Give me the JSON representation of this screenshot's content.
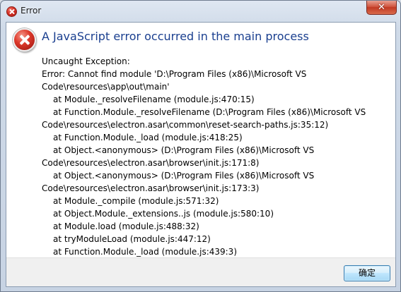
{
  "window": {
    "title": "Error",
    "close_label": "✕"
  },
  "dialog": {
    "heading": "A JavaScript error occurred in the main process",
    "message_lines": [
      {
        "text": "Uncaught Exception:",
        "indent": false
      },
      {
        "text": "Error: Cannot find module 'D:\\Program Files (x86)\\Microsoft VS",
        "indent": false
      },
      {
        "text": "Code\\resources\\app\\out\\main'",
        "indent": false
      },
      {
        "text": "at Module._resolveFilename (module.js:470:15)",
        "indent": true
      },
      {
        "text": "at Function.Module._resolveFilename (D:\\Program Files (x86)\\Microsoft VS",
        "indent": true
      },
      {
        "text": "Code\\resources\\electron.asar\\common\\reset-search-paths.js:35:12)",
        "indent": false
      },
      {
        "text": "at Function.Module._load (module.js:418:25)",
        "indent": true
      },
      {
        "text": "at Object.<anonymous> (D:\\Program Files (x86)\\Microsoft VS",
        "indent": true
      },
      {
        "text": "Code\\resources\\electron.asar\\browser\\init.js:171:8)",
        "indent": false
      },
      {
        "text": "at Object.<anonymous> (D:\\Program Files (x86)\\Microsoft VS",
        "indent": true
      },
      {
        "text": "Code\\resources\\electron.asar\\browser\\init.js:173:3)",
        "indent": false
      },
      {
        "text": "at Module._compile (module.js:571:32)",
        "indent": true
      },
      {
        "text": "at Object.Module._extensions..js (module.js:580:10)",
        "indent": true
      },
      {
        "text": "at Module.load (module.js:488:32)",
        "indent": true
      },
      {
        "text": "at tryModuleLoad (module.js:447:12)",
        "indent": true
      },
      {
        "text": "at Function.Module._load (module.js:439:3)",
        "indent": true
      }
    ],
    "ok_label": "确定"
  },
  "colors": {
    "heading": "#1a3f8f",
    "error_icon": "#d63126",
    "button_border": "#3c7fb1"
  },
  "icons": {
    "title": "error-icon",
    "dialog": "error-icon"
  }
}
